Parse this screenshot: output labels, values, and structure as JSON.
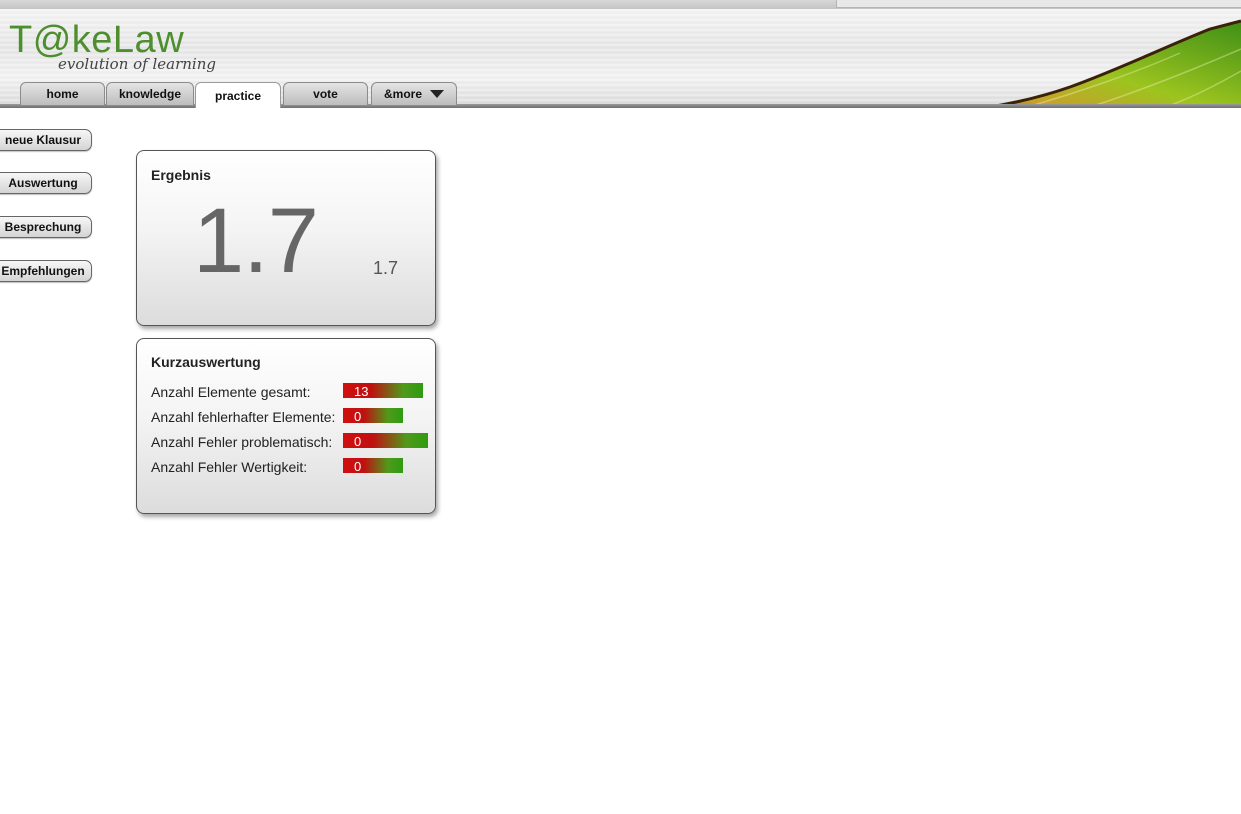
{
  "logo": {
    "title": "T@keLaw",
    "subtitle": "evolution of learning"
  },
  "tabs": [
    {
      "label": "home",
      "active": false
    },
    {
      "label": "knowledge",
      "active": false
    },
    {
      "label": "practice",
      "active": true
    },
    {
      "label": "vote",
      "active": false
    },
    {
      "label": "&more",
      "active": false
    }
  ],
  "sidebar": {
    "buttons": [
      "neue Klausur",
      "Auswertung",
      "Besprechung",
      "Empfehlungen"
    ]
  },
  "result": {
    "title": "Ergebnis",
    "grade": "1.7",
    "grade_small": "1.7"
  },
  "summary": {
    "title": "Kurzauswertung",
    "rows": [
      {
        "label": "Anzahl Elemente gesamt:",
        "value": "13"
      },
      {
        "label": "Anzahl fehlerhafter Elemente:",
        "value": "0"
      },
      {
        "label": "Anzahl Fehler problematisch:",
        "value": "0"
      },
      {
        "label": "Anzahl Fehler Wertigkeit:",
        "value": "0"
      }
    ]
  },
  "colors": {
    "brand_green": "#4d8f2e",
    "bar_red": "#d10f0f",
    "bar_green": "#2f9b10"
  }
}
